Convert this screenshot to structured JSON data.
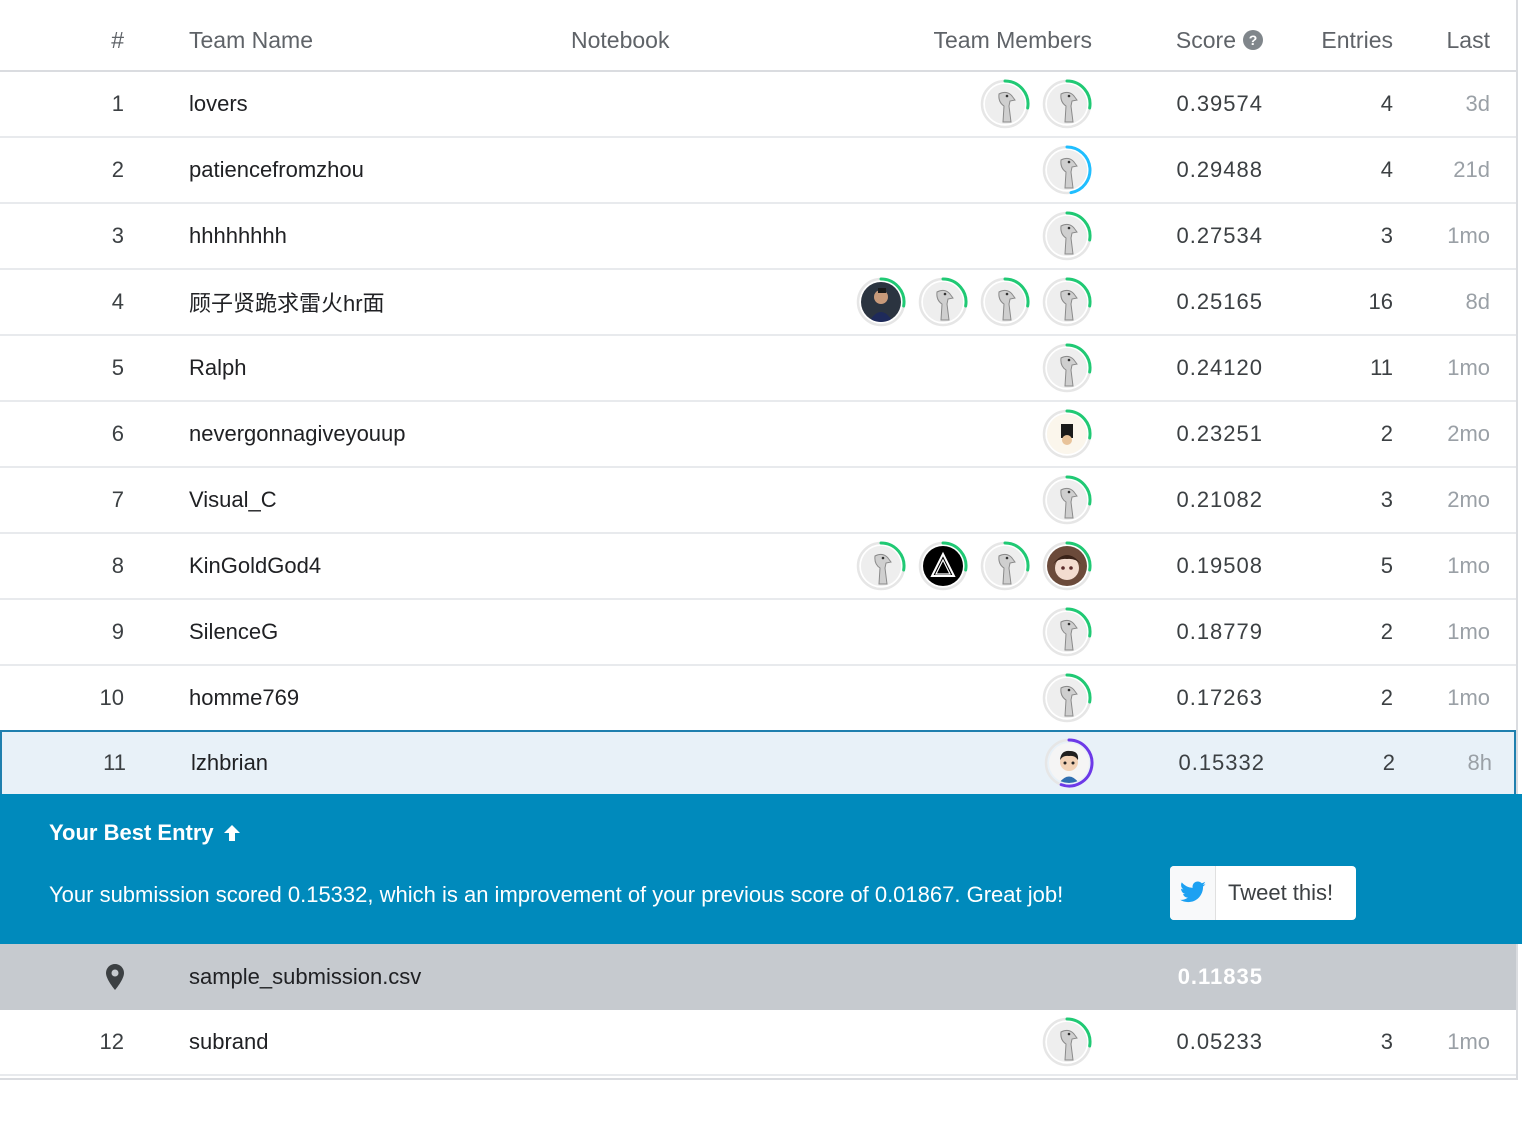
{
  "header": {
    "rank": "#",
    "team_name": "Team Name",
    "notebook": "Notebook",
    "team_members": "Team Members",
    "score": "Score",
    "entries": "Entries",
    "last": "Last"
  },
  "rows": [
    {
      "rank": "1",
      "name": "lovers",
      "score": "0.39574",
      "entries": "4",
      "last": "3d"
    },
    {
      "rank": "2",
      "name": "patiencefromzhou",
      "score": "0.29488",
      "entries": "4",
      "last": "21d"
    },
    {
      "rank": "3",
      "name": "hhhhhhhh",
      "score": "0.27534",
      "entries": "3",
      "last": "1mo"
    },
    {
      "rank": "4",
      "name": "顾子贤跪求雷火hr面",
      "score": "0.25165",
      "entries": "16",
      "last": "8d"
    },
    {
      "rank": "5",
      "name": "Ralph",
      "score": "0.24120",
      "entries": "11",
      "last": "1mo"
    },
    {
      "rank": "6",
      "name": "nevergonnagiveyouup",
      "score": "0.23251",
      "entries": "2",
      "last": "2mo"
    },
    {
      "rank": "7",
      "name": "Visual_C",
      "score": "0.21082",
      "entries": "3",
      "last": "2mo"
    },
    {
      "rank": "8",
      "name": "KinGoldGod4",
      "score": "0.19508",
      "entries": "5",
      "last": "1mo"
    },
    {
      "rank": "9",
      "name": "SilenceG",
      "score": "0.18779",
      "entries": "2",
      "last": "1mo"
    },
    {
      "rank": "10",
      "name": "homme769",
      "score": "0.17263",
      "entries": "2",
      "last": "1mo"
    },
    {
      "rank": "11",
      "name": "lzhbrian",
      "score": "0.15332",
      "entries": "2",
      "last": "8h"
    },
    {
      "rank": "12",
      "name": "subrand",
      "score": "0.05233",
      "entries": "3",
      "last": "1mo"
    }
  ],
  "best_entry": {
    "title": "Your Best Entry",
    "message": "Your submission scored 0.15332, which is an improvement of your previous score of 0.01867. Great job!",
    "tweet_label": "Tweet this!"
  },
  "benchmark": {
    "name": "sample_submission.csv",
    "score": "0.11835"
  },
  "colors": {
    "accent": "#008abc",
    "ring_green": "#20c974",
    "ring_blue": "#20beff",
    "ring_purple": "#6d39e8",
    "highlight_border": "#1f7fae"
  }
}
